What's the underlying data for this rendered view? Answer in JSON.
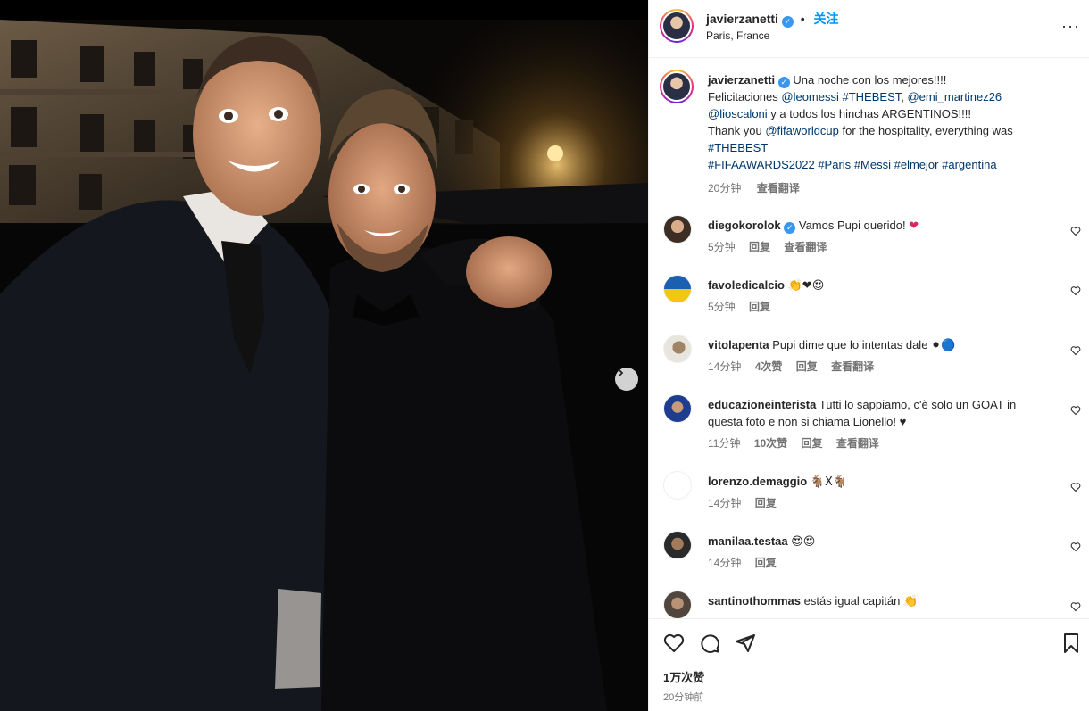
{
  "post": {
    "username": "javierzanetti",
    "follow_label": "关注",
    "location": "Paris, France",
    "more_label": "···"
  },
  "caption": {
    "username": "javierzanetti",
    "line1": "Una noche con los mejores!!!!",
    "line2_a": "Felicitaciones ",
    "mention_leomessi": "@leomessi",
    "tag_thebest": "#THEBEST",
    "line2_sep": ", ",
    "mention_emi": "@emi_martinez26",
    "mention_lioscaloni": "@lioscaloni",
    "line3_rest": " y a todos los hinchas ARGENTINOS!!!!",
    "line4_a": "Thank you ",
    "mention_fifa": "@fifaworldcup",
    "line4_b": " for the hospitality, everything was",
    "tag_thebest2": "#THEBEST",
    "tags_line": [
      "#FIFAAWARDS2022",
      "#Paris",
      "#Messi",
      "#elmejor",
      "#argentina"
    ],
    "time": "20分钟",
    "translate": "查看翻译"
  },
  "comments": [
    {
      "user": "diegokorolok",
      "verified": true,
      "text": "Vamos Pupi querido!",
      "emoji": "❤",
      "time": "5分钟",
      "likes": "",
      "reply": "回复",
      "translate": "查看翻译"
    },
    {
      "user": "favoledicalcio",
      "verified": false,
      "text": "",
      "emoji": "👏❤😍",
      "time": "5分钟",
      "likes": "",
      "reply": "回复",
      "translate": ""
    },
    {
      "user": "vitolapenta",
      "verified": false,
      "text": "Pupi dime que lo intentas dale",
      "emoji": "⚫🔵",
      "time": "14分钟",
      "likes": "4次赞",
      "reply": "回复",
      "translate": "查看翻译"
    },
    {
      "user": "educazioneinterista",
      "verified": false,
      "text": "Tutti lo sappiamo, c'è solo un GOAT in questa foto e non si chiama Lionello! ♥",
      "emoji": "",
      "time": "11分钟",
      "likes": "10次赞",
      "reply": "回复",
      "translate": "查看翻译"
    },
    {
      "user": "lorenzo.demaggio",
      "verified": false,
      "text": "",
      "emoji": "🐐X🐐",
      "time": "14分钟",
      "likes": "",
      "reply": "回复",
      "translate": ""
    },
    {
      "user": "manilaa.testaa",
      "verified": false,
      "text": "",
      "emoji": "😍😍",
      "time": "14分钟",
      "likes": "",
      "reply": "回复",
      "translate": ""
    },
    {
      "user": "santinothommas",
      "verified": false,
      "text": "estás igual capitán",
      "emoji": "👏",
      "time": "",
      "likes": "",
      "reply": "",
      "translate": ""
    }
  ],
  "footer": {
    "likes": "1万次赞",
    "posted": "20分钟前"
  },
  "icons": {
    "verified": "verified-badge-icon",
    "heart": "heart-icon",
    "comment": "comment-icon",
    "share": "share-icon",
    "save": "bookmark-icon",
    "next": "chevron-right-icon"
  },
  "colors": {
    "link": "#00376b",
    "follow": "#0095f6",
    "verified": "#3897f0",
    "muted": "#737373"
  }
}
